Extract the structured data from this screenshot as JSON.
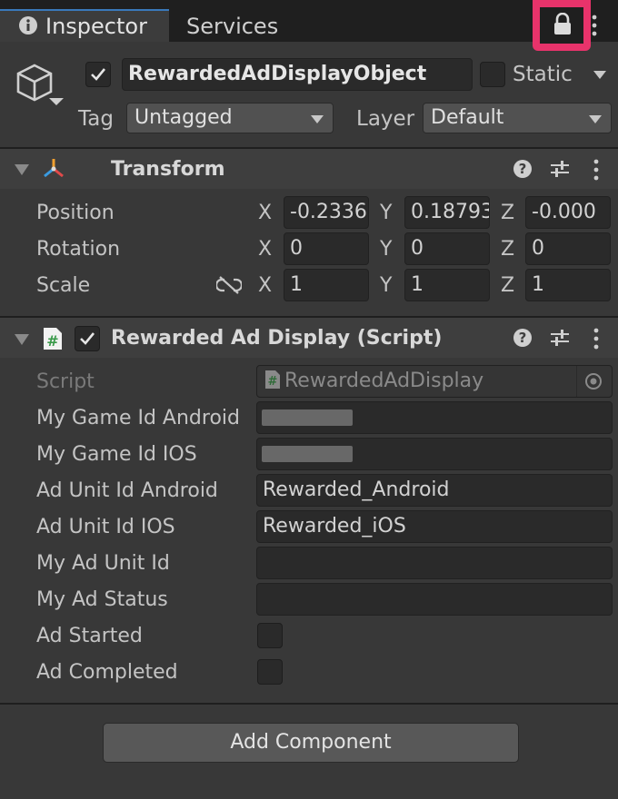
{
  "tabs": {
    "inspector": "Inspector",
    "services": "Services"
  },
  "object": {
    "name": "RewardedAdDisplayObject",
    "static_label": "Static",
    "tag_label": "Tag",
    "tag_value": "Untagged",
    "layer_label": "Layer",
    "layer_value": "Default"
  },
  "transform": {
    "title": "Transform",
    "position": {
      "label": "Position",
      "x": "-0.2336",
      "y": "0.18793",
      "z": "-0.000"
    },
    "rotation": {
      "label": "Rotation",
      "x": "0",
      "y": "0",
      "z": "0"
    },
    "scale": {
      "label": "Scale",
      "x": "1",
      "y": "1",
      "z": "1"
    },
    "axis_x": "X",
    "axis_y": "Y",
    "axis_z": "Z"
  },
  "script_component": {
    "title": "Rewarded Ad Display (Script)",
    "script_label": "Script",
    "script_value": "RewardedAdDisplay",
    "fields": {
      "game_id_android": {
        "label": "My Game Id Android",
        "value": ""
      },
      "game_id_ios": {
        "label": "My Game Id IOS",
        "value": ""
      },
      "ad_unit_android": {
        "label": "Ad Unit Id Android",
        "value": "Rewarded_Android"
      },
      "ad_unit_ios": {
        "label": "Ad Unit Id IOS",
        "value": "Rewarded_iOS"
      },
      "my_ad_unit": {
        "label": "My Ad Unit Id",
        "value": ""
      },
      "my_ad_status": {
        "label": "My Ad Status",
        "value": ""
      },
      "ad_started": {
        "label": "Ad Started"
      },
      "ad_completed": {
        "label": "Ad Completed"
      }
    }
  },
  "add_component": "Add Component",
  "colors": {
    "lock_highlight": "#e8336b",
    "background": "#383838",
    "tab_accent": "#3a79bb"
  }
}
